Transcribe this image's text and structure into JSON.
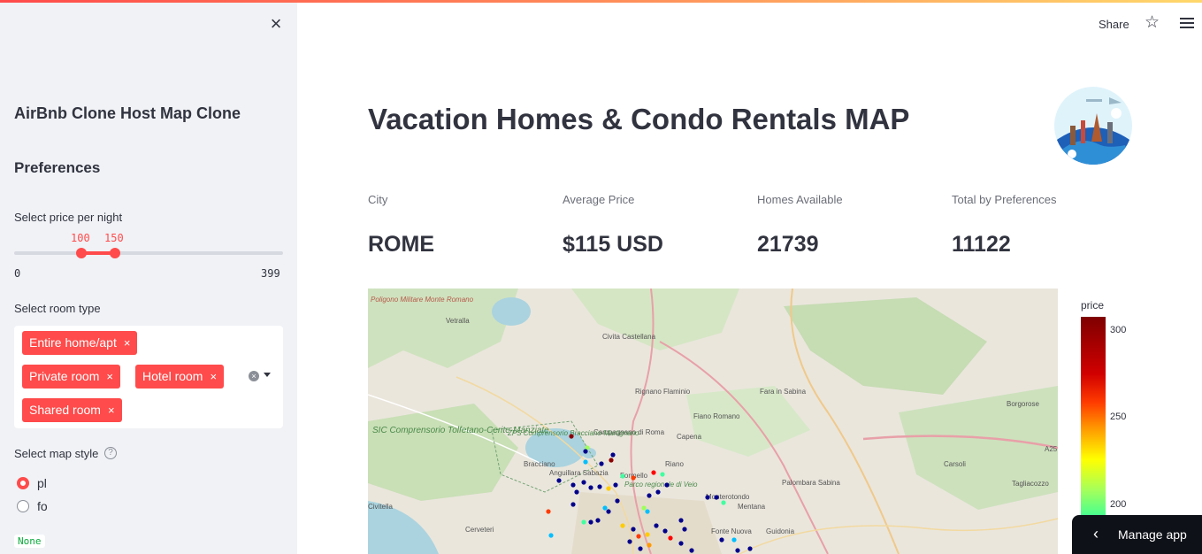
{
  "sidebar": {
    "close_glyph": "×",
    "app_title": "AirBnb Clone Host Map Clone",
    "preferences_heading": "Preferences",
    "price_slider": {
      "label": "Select price per night",
      "low": "100",
      "high": "150",
      "min": "0",
      "max": "399"
    },
    "room_type": {
      "label": "Select room type",
      "selected": [
        "Entire home/apt",
        "Private room",
        "Hotel room",
        "Shared room"
      ],
      "remove_glyph": "×"
    },
    "map_style": {
      "label": "Select map style",
      "help_glyph": "?",
      "options": [
        "pl",
        "fo"
      ],
      "selected": "pl"
    },
    "output_badge": "None"
  },
  "header": {
    "share_label": "Share",
    "star_icon": "☆"
  },
  "main": {
    "title": "Vacation Homes & Condo Rentals MAP",
    "metrics": [
      {
        "label": "City",
        "value": "ROME"
      },
      {
        "label": "Average Price",
        "value": "$115 USD"
      },
      {
        "label": "Homes Available",
        "value": "21739"
      },
      {
        "label": "Total by Preferences",
        "value": "11122"
      }
    ],
    "map_labels": [
      "Poligono Militare Monte Romano",
      "Vetralla",
      "Civita Castellana",
      "Rignano Flaminio",
      "Fara in Sabina",
      "Fiano Romano",
      "Capena",
      "Borgorose",
      "Campagnano di Roma",
      "ZPS Comprensorio Bracciano-Martignano",
      "SIC Comprensorio Tolfetano-Cerite-Manziate",
      "Bracciano",
      "Anguillara Sabazia",
      "Formello",
      "Parco regionale di Veio",
      "Riano",
      "Monterotondo",
      "Mentana",
      "Palombara Sabina",
      "Carsoli",
      "Tagliacozzo",
      "Cerveteri",
      "Fonte Nuova",
      "Guidonia",
      "Civitella",
      "A25"
    ],
    "colorbar": {
      "title": "price",
      "ticks": [
        "300",
        "250",
        "200"
      ]
    },
    "colors": {
      "accent": "#ff4b4b",
      "text": "#31333f",
      "sidebar_bg": "#f0f2f6"
    }
  },
  "manage_app": {
    "label": "Manage app",
    "chevron": "‹"
  }
}
